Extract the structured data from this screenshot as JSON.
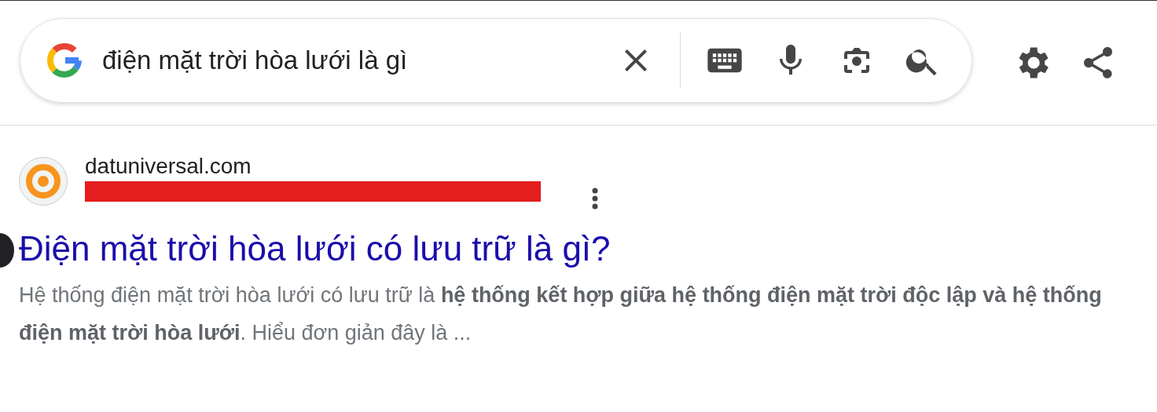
{
  "search": {
    "value": "điện mặt trời hòa lưới là gì"
  },
  "result": {
    "site_name": "datuniversal.com",
    "url_redacted": true,
    "title": "Điện mặt trời hòa lưới có lưu trữ là gì?",
    "snippet": "Hệ thống điện mặt trời hòa lưới có lưu trữ là **hệ thống kết hợp giữa hệ thống điện mặt trời độc lập và hệ thống điện mặt trời hòa lưới**. Hiểu đơn giản đây là ..."
  }
}
